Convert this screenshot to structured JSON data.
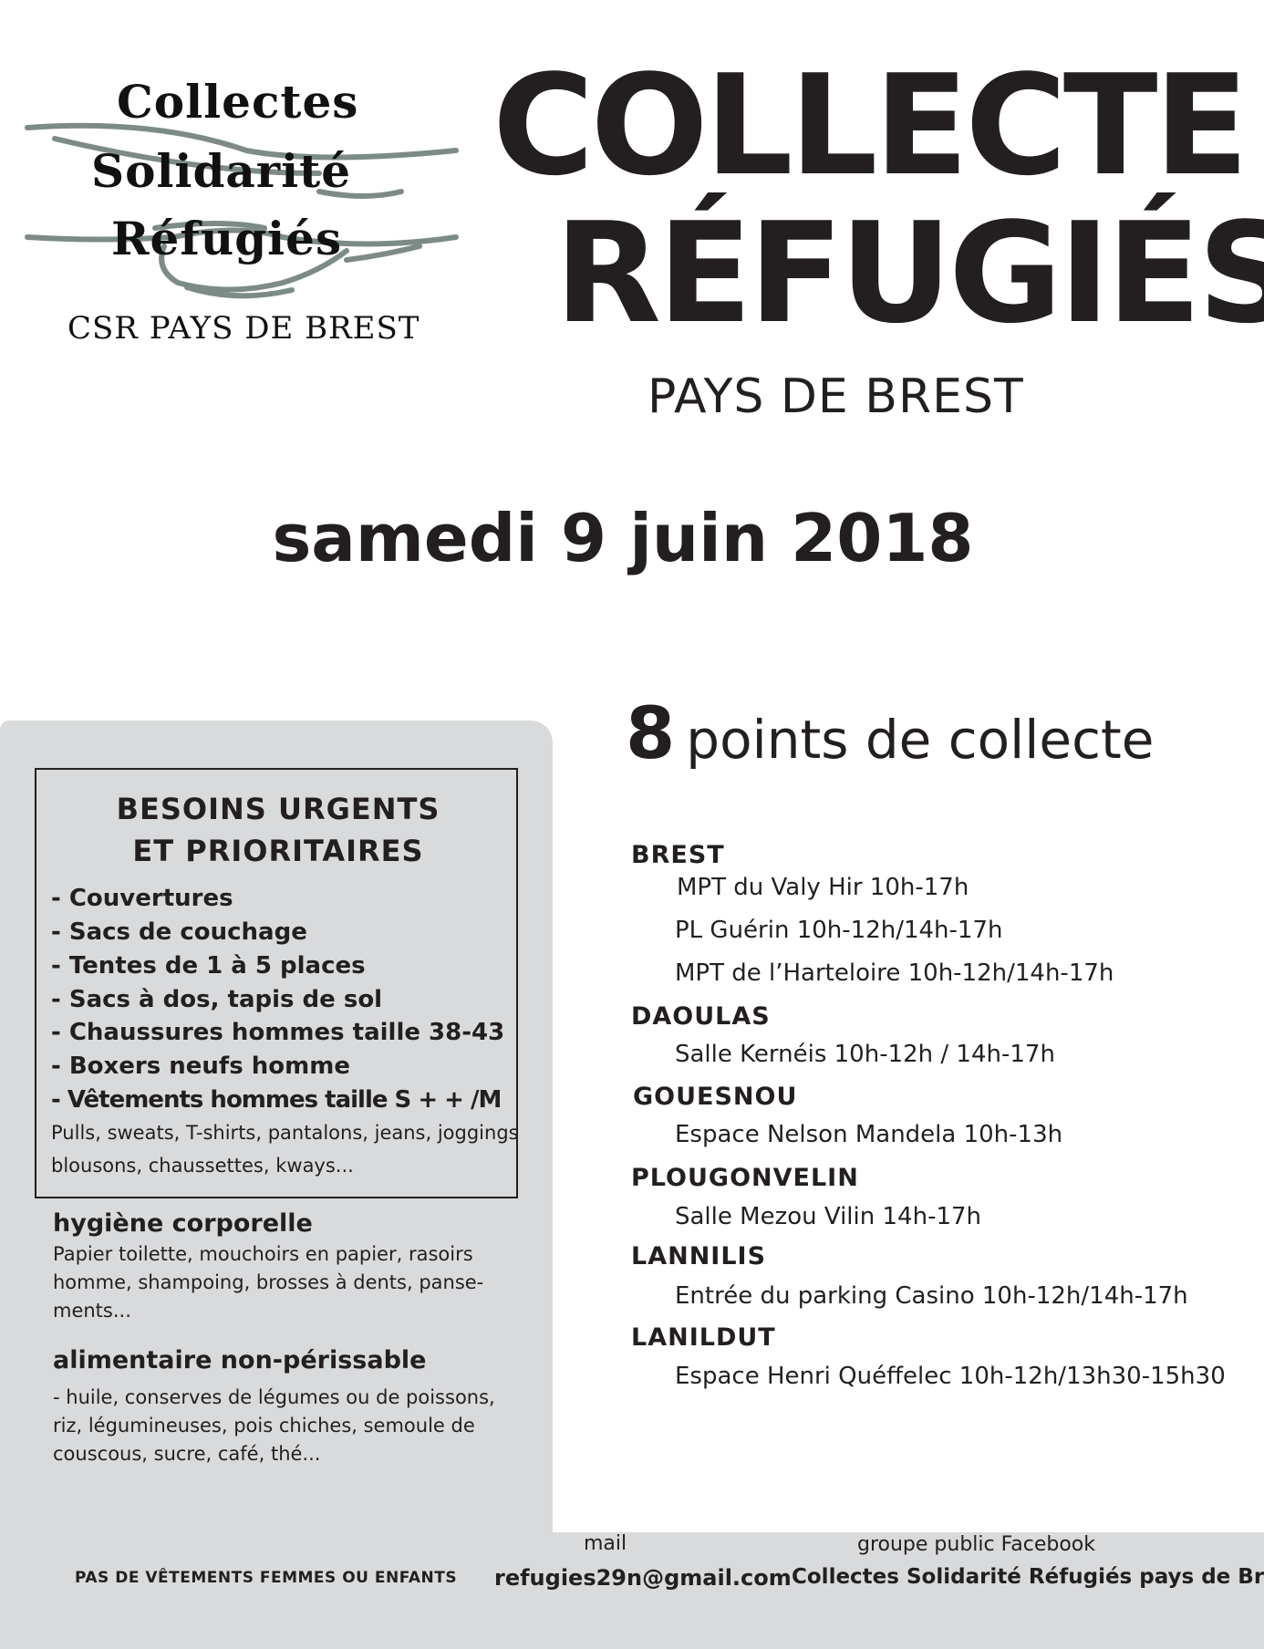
{
  "logo": {
    "line1": "Collectes",
    "line2": "Solidarité",
    "line3": "Réfugiés",
    "line4": "CSR PAYS DE BREST"
  },
  "title": {
    "line1": "COLLECTE",
    "line2": "RÉFUGIÉS",
    "subtitle": "PAYS DE BREST"
  },
  "date": "samedi 9 juin 2018",
  "needs_box": {
    "title_line1": "BESOINS URGENTS",
    "title_line2": "ET PRIORITAIRES",
    "items": [
      "-  Couvertures",
      "- Sacs de couchage",
      "- Tentes de 1 à 5 places",
      "- Sacs à dos, tapis de sol",
      "- Chaussures hommes taille 38-43",
      "- Boxers neufs homme",
      "- Vêtements hommes taille S + + /M"
    ],
    "note_line1": "Pulls, sweats, T-shirts, pantalons, jeans, joggings",
    "note_line2": "blousons, chaussettes, kways..."
  },
  "hygiene": {
    "title": "hygiène corporelle",
    "text": "Papier toilette, mouchoirs en papier, rasoirs homme, shampoing, brosses à dents, panse-ments..."
  },
  "food": {
    "title": "alimentaire non-périssable",
    "text": "- huile, conserves de légumes ou de poissons, riz, légumineuses, pois chiches, semoule de couscous, sucre, café, thé..."
  },
  "points": {
    "count": "8",
    "label": "points de collecte"
  },
  "locations": [
    {
      "town": "BREST",
      "places": [
        "MPT du Valy Hir 10h-17h",
        "PL Guérin 10h-12h/14h-17h",
        "MPT de l’Harteloire 10h-12h/14h-17h"
      ]
    },
    {
      "town": "DAOULAS",
      "places": [
        "Salle Kernéis 10h-12h / 14h-17h"
      ]
    },
    {
      "town": "GOUESNOU",
      "places": [
        "Espace Nelson Mandela 10h-13h"
      ]
    },
    {
      "town": "PLOUGONVELIN",
      "places": [
        "Salle Mezou Vilin 14h-17h"
      ]
    },
    {
      "town": "LANNILIS",
      "places": [
        "Entrée du parking Casino 10h-12h/14h-17h"
      ]
    },
    {
      "town": "LANILDUT",
      "places": [
        "Espace Henri Quéffelec 10h-12h/13h30-15h30"
      ]
    }
  ],
  "footer": {
    "warning": "PAS DE VÊTEMENTS FEMMES OU ENFANTS",
    "mail_label": "mail",
    "mail": "refugies29n@gmail.com",
    "facebook_label": "groupe public Facebook",
    "facebook": "Collectes Solidarité Réfugiés pays de Brest"
  }
}
